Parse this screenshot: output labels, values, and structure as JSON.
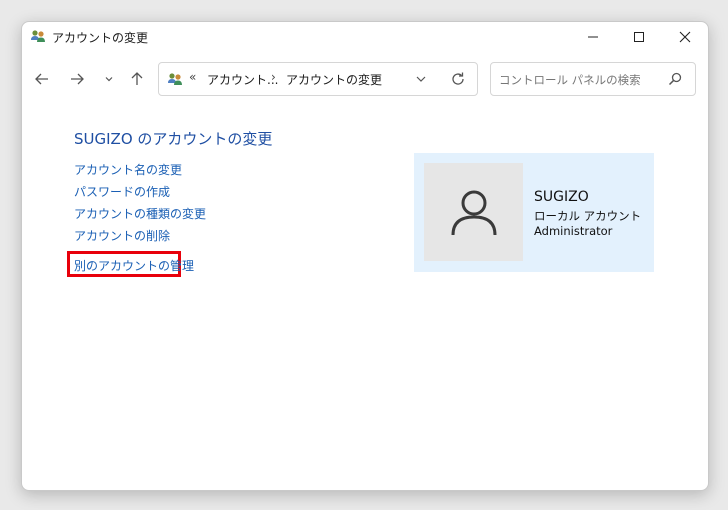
{
  "window": {
    "title": "アカウントの変更"
  },
  "address_bar": {
    "overflow_glyph": "«",
    "crumbs": [
      "アカウント...",
      "アカウントの変更"
    ],
    "separator": "›"
  },
  "search": {
    "placeholder": "コントロール パネルの検索"
  },
  "page": {
    "title": "SUGIZO のアカウントの変更",
    "tasks": [
      {
        "label": "アカウント名の変更"
      },
      {
        "label": "パスワードの作成"
      },
      {
        "label": "アカウントの種類の変更"
      },
      {
        "label": "アカウントの削除"
      },
      {
        "label": "別のアカウントの管理",
        "highlighted": true
      }
    ]
  },
  "user": {
    "name": "SUGIZO",
    "account_type": "ローカル アカウント",
    "role": "Administrator"
  },
  "colors": {
    "link": "#1a5fb4",
    "title": "#1f4fa3",
    "highlight": "#e8000b",
    "card_bg": "#e3f1fd"
  },
  "icons": {
    "app": "users-icon",
    "back": "arrow-left-icon",
    "forward": "arrow-right-icon",
    "recent": "chevron-down-icon",
    "up": "arrow-up-icon",
    "refresh": "refresh-icon",
    "search": "search-icon",
    "avatar": "user-silhouette-icon"
  }
}
